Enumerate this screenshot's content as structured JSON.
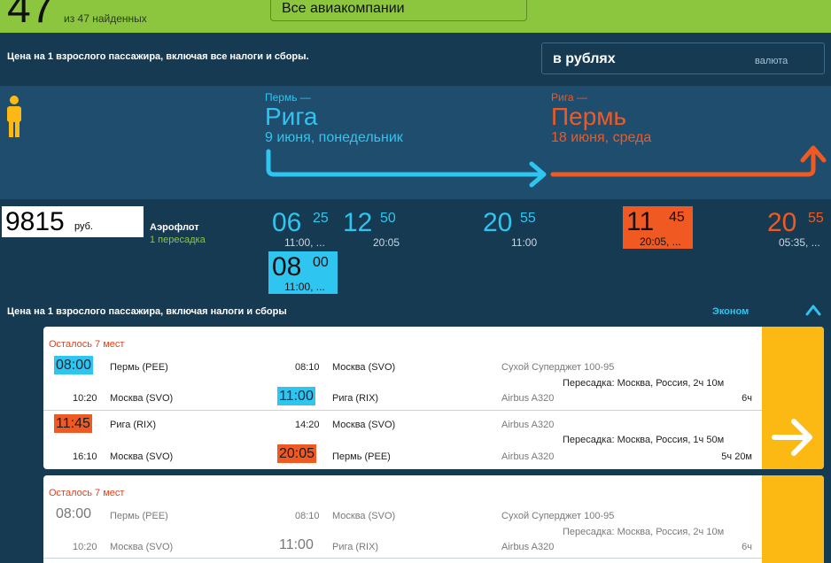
{
  "header": {
    "count": "47",
    "found_text": "из 47 найденных",
    "airline_filter": "Все авиакомпании"
  },
  "note_top": "Цена на 1 взрослого пассажира, включая все налоги и сборы.",
  "currency": {
    "value": "в рублях",
    "label": "валюта"
  },
  "route": {
    "outbound": {
      "from": "Пермь —",
      "to": "Рига",
      "date": "9 июня, понедельник"
    },
    "return": {
      "from": "Рига —",
      "to": "Пермь",
      "date": "18 июня, среда"
    }
  },
  "offer": {
    "price": "9815",
    "price_unit": "руб.",
    "carrier": "Аэрофлот",
    "stops": "1 пересадка",
    "times": [
      {
        "h": "06",
        "m": "25",
        "sub": "11:00, ..."
      },
      {
        "h": "12",
        "m": "50",
        "sub": "20:05"
      },
      {
        "h": "20",
        "m": "55",
        "sub": "11:00"
      },
      {
        "h": "11",
        "m": "45",
        "sub": "20:05, ..."
      },
      {
        "h": "20",
        "m": "55",
        "sub": "05:35, ..."
      },
      {
        "h": "08",
        "m": "00",
        "sub": "11:00, ..."
      }
    ]
  },
  "class_note": "Цена на 1 взрослого пассажира, включая налоги и сборы",
  "class_label": "Эконом",
  "cards": [
    {
      "seats": "Осталось 7 мест",
      "rows": {
        "dep1": "08:00",
        "from1": "Пермь (PEE)",
        "arr1": "08:10",
        "to1": "Москва (SVO)",
        "plane1": "Сухой Суперджет 100-95",
        "transfer1": "Пересадка: Москва, Россия, 2ч 10м",
        "dep2": "10:20",
        "from2": "Москва (SVO)",
        "arr2": "11:00",
        "to2": "Рига (RIX)",
        "plane2": "Airbus A320",
        "dur1": "6ч",
        "dep3": "11:45",
        "from3": "Рига (RIX)",
        "arr3": "14:20",
        "to3": "Москва (SVO)",
        "plane3": "Airbus A320",
        "transfer2": "Пересадка: Москва, Россия, 1ч 50м",
        "dep4": "16:10",
        "from4": "Москва (SVO)",
        "arr4": "20:05",
        "to4": "Пермь (PEE)",
        "plane4": "Airbus A320",
        "dur2": "5ч 20м"
      }
    },
    {
      "seats": "Осталось 7 мест",
      "rows": {
        "dep1": "08:00",
        "from1": "Пермь (PEE)",
        "arr1": "08:10",
        "to1": "Москва (SVO)",
        "plane1": "Сухой Суперджет 100-95",
        "transfer1": "Пересадка: Москва, Россия, 2ч 10м",
        "dep2": "10:20",
        "from2": "Москва (SVO)",
        "arr2": "11:00",
        "to2": "Рига (RIX)",
        "plane2": "Airbus A320",
        "dur1": "6ч"
      }
    }
  ],
  "colors": {
    "green": "#8cc63f",
    "blue": "#2ec5f0",
    "orange": "#f05a22",
    "yellow": "#fdb913",
    "navy": "#163a52"
  }
}
